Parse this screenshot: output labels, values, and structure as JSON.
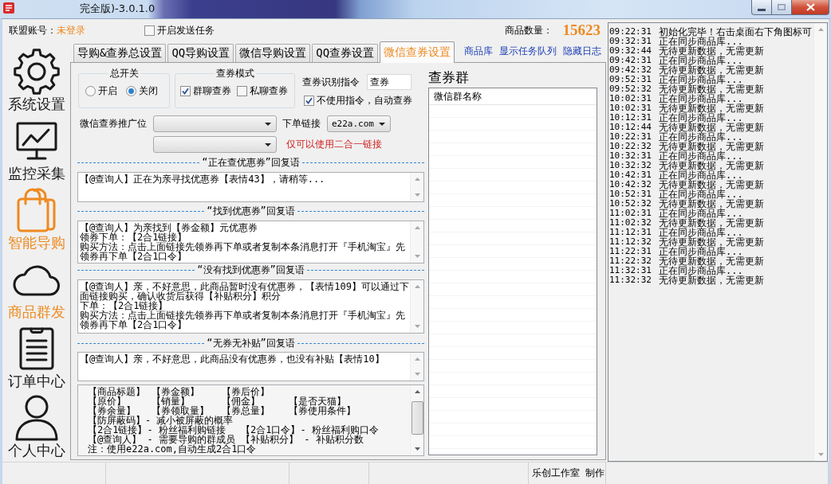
{
  "window": {
    "title": "完全版)-3.0.1.0"
  },
  "header": {
    "account_label": "联盟账号：",
    "account_status": "未登录",
    "send_task": {
      "label": "开启发送任务",
      "checked": false
    },
    "product_count_label": "商品数量：",
    "product_count": "15623"
  },
  "sidebar": {
    "items": [
      {
        "label": "系统设置",
        "kind": "settings",
        "selected": false,
        "hovered": false
      },
      {
        "label": "监控采集",
        "kind": "monitor",
        "selected": false,
        "hovered": false
      },
      {
        "label": "智能导购",
        "kind": "bag",
        "selected": true,
        "hovered": false
      },
      {
        "label": "商品群发",
        "kind": "cloud",
        "selected": false,
        "hovered": true
      },
      {
        "label": "订单中心",
        "kind": "clipboard",
        "selected": false,
        "hovered": false
      },
      {
        "label": "个人中心",
        "kind": "person",
        "selected": false,
        "hovered": false
      }
    ]
  },
  "tabs": [
    {
      "label": "导购&查券总设置",
      "selected": false
    },
    {
      "label": "QQ导购设置",
      "selected": false
    },
    {
      "label": "微信导购设置",
      "selected": false
    },
    {
      "label": "QQ查券设置",
      "selected": false
    },
    {
      "label": "微信查券设置",
      "selected": true
    }
  ],
  "links": [
    "商品库",
    "显示任务队列",
    "隐藏日志"
  ],
  "settings": {
    "master_switch": {
      "title": "总开关",
      "options": [
        {
          "label": "开启",
          "selected": false
        },
        {
          "label": "关闭",
          "selected": true
        }
      ]
    },
    "query_mode": {
      "title": "查券模式",
      "options": [
        {
          "label": "群聊查券",
          "checked": true
        },
        {
          "label": "私聊查券",
          "checked": false
        }
      ]
    },
    "command": {
      "label": "查券识别指令",
      "value": "查券"
    },
    "auto_query": {
      "label": "不使用指令，自动查券",
      "checked": true
    },
    "promo_position": {
      "label": "微信查券推广位"
    },
    "order_link": {
      "label": "下单链接",
      "value": "e22a.com"
    },
    "link_note": "仅可以使用二合一链接"
  },
  "replies": [
    {
      "title": "“正在查优惠券”回复语",
      "lines": [
        "【@查询人】正在为亲寻找优惠券【表情43】，请稍等..."
      ]
    },
    {
      "title": "“找到优惠券”回复语",
      "lines": [
        "【@查询人】为亲找到【券金额】元优惠券",
        "领券下单：【2合1链接】",
        "购买方法：点击上面链接先领券再下单或者复制本条消息打开『手机淘宝』先领券再下单【2合1口令】"
      ]
    },
    {
      "title": "“没有找到优惠券”回复语",
      "lines": [
        "【@查询人】亲，不好意思，此商品暂时没有优惠券，【表情109】可以通过下面链接购买，确认收货后获得【补贴积分】积分",
        "下单：【2合1链接】",
        "购买方法：点击上面链接先领券再下单或者复制本条消息打开『手机淘宝』先领券再下单【2合1口令】"
      ]
    },
    {
      "title": "“无券无补贴”回复语",
      "lines": [
        "【@查询人】亲，不好意思，此商品没有优惠券，也没有补贴【表情10】"
      ]
    }
  ],
  "variables": {
    "rows": [
      [
        "【商品标题】",
        "【券金额】",
        "【券后价】"
      ],
      [
        "【原价】",
        "【销量】",
        "【佣金】",
        "【是否天猫】"
      ],
      [
        "【券余量】",
        "【券领取量】",
        "【券总量】",
        "【券使用条件】"
      ],
      [
        "【防屏蔽码】- 减小被屏蔽的概率"
      ],
      [
        "【2合1链接】- 粉丝福利购链接",
        "【2合1口令】- 粉丝福利购口令"
      ],
      [
        "【@查询人】 - 需要导购的群成员",
        "【补贴积分】 - 补贴积分数"
      ]
    ],
    "note": "注：使用e22a.com,自动生成2合1口令"
  },
  "groups": {
    "title": "查券群",
    "columns": [
      "微信群名称"
    ]
  },
  "log": [
    {
      "time": "09:22:31",
      "message": "初始化完毕！右击桌面右下角图标可"
    },
    {
      "time": "09:32:31",
      "message": "正在同步商品库..."
    },
    {
      "time": "09:32:44",
      "message": "无待更新数据，无需更新"
    },
    {
      "time": "09:42:31",
      "message": "正在同步商品库..."
    },
    {
      "time": "09:42:32",
      "message": "无待更新数据，无需更新"
    },
    {
      "time": "09:52:31",
      "message": "正在同步商品库..."
    },
    {
      "time": "09:52:32",
      "message": "无待更新数据，无需更新"
    },
    {
      "time": "10:02:31",
      "message": "正在同步商品库..."
    },
    {
      "time": "10:02:31",
      "message": "无待更新数据，无需更新"
    },
    {
      "time": "10:12:31",
      "message": "正在同步商品库..."
    },
    {
      "time": "10:12:44",
      "message": "无待更新数据，无需更新"
    },
    {
      "time": "10:22:31",
      "message": "正在同步商品库..."
    },
    {
      "time": "10:22:32",
      "message": "无待更新数据，无需更新"
    },
    {
      "time": "10:32:31",
      "message": "正在同步商品库..."
    },
    {
      "time": "10:32:32",
      "message": "无待更新数据，无需更新"
    },
    {
      "time": "10:42:31",
      "message": "正在同步商品库..."
    },
    {
      "time": "10:42:32",
      "message": "无待更新数据，无需更新"
    },
    {
      "time": "10:52:31",
      "message": "正在同步商品库..."
    },
    {
      "time": "10:52:32",
      "message": "无待更新数据，无需更新"
    },
    {
      "time": "11:02:31",
      "message": "正在同步商品库..."
    },
    {
      "time": "11:02:32",
      "message": "无待更新数据，无需更新"
    },
    {
      "time": "11:12:31",
      "message": "正在同步商品库..."
    },
    {
      "time": "11:12:32",
      "message": "无待更新数据，无需更新"
    },
    {
      "time": "11:22:31",
      "message": "正在同步商品库..."
    },
    {
      "time": "11:22:32",
      "message": "无待更新数据，无需更新"
    },
    {
      "time": "11:32:31",
      "message": "正在同步商品库..."
    },
    {
      "time": "11:32:32",
      "message": "无待更新数据，无需更新"
    }
  ],
  "status_bar": {
    "credit": "乐创工作室 制作"
  }
}
